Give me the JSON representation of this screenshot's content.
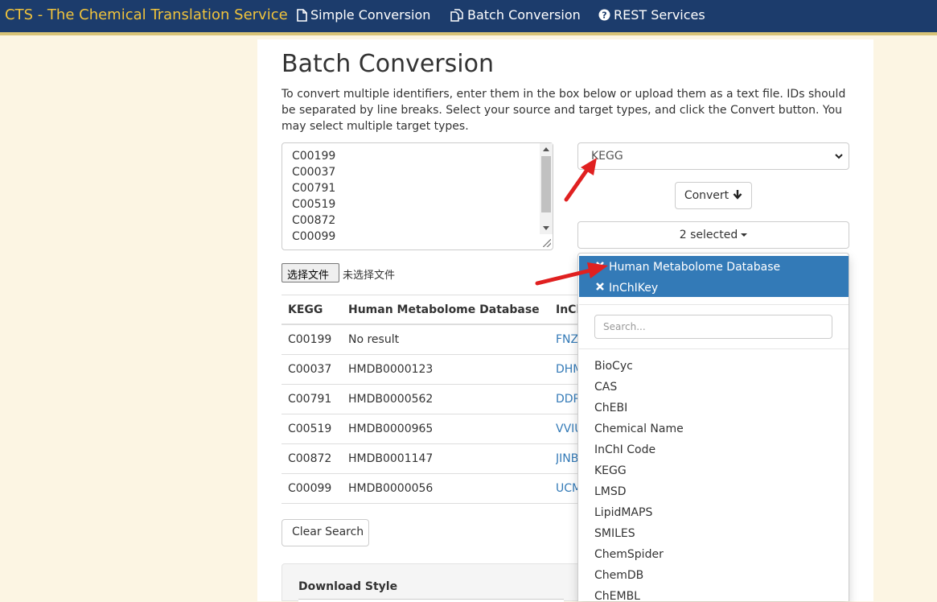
{
  "navbar": {
    "brand": "CTS - The Chemical Translation Service",
    "items": [
      {
        "label": "Simple Conversion",
        "icon": "file-icon"
      },
      {
        "label": "Batch Conversion",
        "icon": "files-icon"
      },
      {
        "label": "REST Services",
        "icon": "question-circle-icon"
      }
    ],
    "colors": {
      "background": "#1c3c6c",
      "brand": "#f0c33c",
      "accent_border": "#d8c377"
    }
  },
  "page": {
    "title": "Batch Conversion",
    "intro": "To convert multiple identifiers, enter them in the box below or upload them as a text file. IDs should be separated by line breaks. Select your source and target types, and click the Convert button. You may select multiple target types."
  },
  "input": {
    "ids": [
      "C00199",
      "C00037",
      "C00791",
      "C00519",
      "C00872",
      "C00099"
    ],
    "file_button": "选择文件",
    "file_status": "未选择文件"
  },
  "controls": {
    "source_type": "KEGG",
    "convert_label": "Convert",
    "targets_summary": "2 selected"
  },
  "results": {
    "headers": [
      "KEGG",
      "Human Metabolome Database",
      "InChIKey"
    ],
    "rows": [
      [
        "C00199",
        "No result",
        "FNZ"
      ],
      [
        "C00037",
        "HMDB0000123",
        "DHM"
      ],
      [
        "C00791",
        "HMDB0000562",
        "DDR"
      ],
      [
        "C00519",
        "HMDB0000965",
        "VVIU"
      ],
      [
        "C00872",
        "HMDB0001147",
        "JINB"
      ],
      [
        "C00099",
        "HMDB0000056",
        "UCM"
      ]
    ]
  },
  "buttons": {
    "clear_search": "Clear Search"
  },
  "download": {
    "label": "Download Style"
  },
  "dropdown": {
    "selected": [
      "Human Metabolome Database",
      "InChIKey"
    ],
    "search_placeholder": "Search...",
    "options": [
      "BioCyc",
      "CAS",
      "ChEBI",
      "Chemical Name",
      "InChI Code",
      "KEGG",
      "LMSD",
      "LipidMAPS",
      "SMILES",
      "ChemSpider",
      "ChemDB",
      "ChEMBL"
    ],
    "selected_color": "#337ab7"
  },
  "annotations": {
    "arrow_color": "#e02020"
  }
}
